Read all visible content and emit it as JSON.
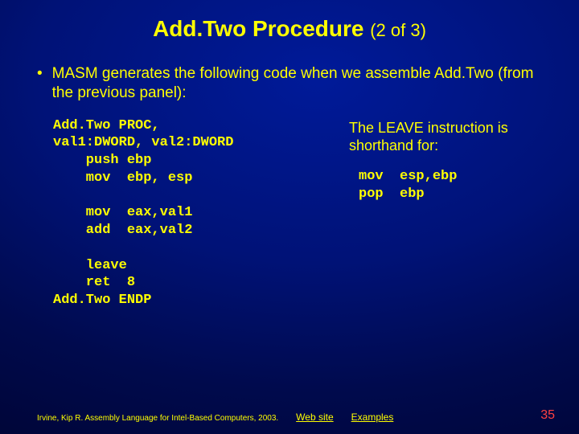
{
  "title": {
    "main": "Add.Two Procedure",
    "pager": "(2 of 3)"
  },
  "bullet": "MASM generates the following code when we assemble Add.Two (from the previous panel):",
  "code_main": "Add.Two PROC,\nval1:DWORD, val2:DWORD\n    push ebp\n    mov  ebp, esp\n\n    mov  eax,val1\n    add  eax,val2\n\n    leave\n    ret  8\nAdd.Two ENDP",
  "note_text": "The LEAVE instruction is shorthand for:",
  "note_code": "mov  esp,ebp\npop  ebp",
  "footer": {
    "credit": "Irvine, Kip R. Assembly Language for Intel-Based Computers, 2003.",
    "link1": "Web site",
    "link2": "Examples",
    "page": "35"
  }
}
